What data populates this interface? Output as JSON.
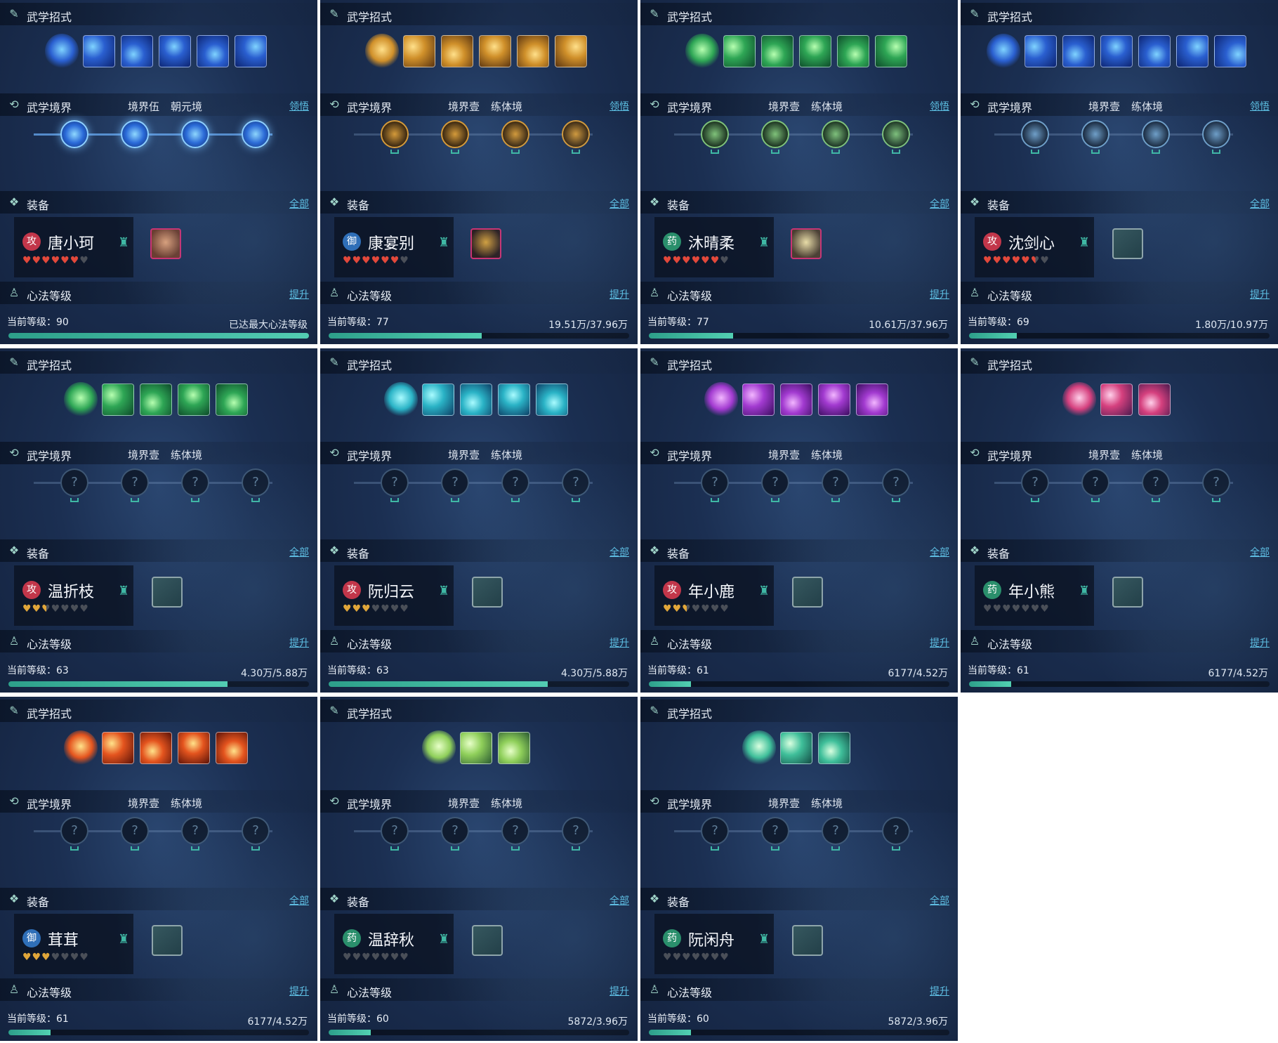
{
  "labels": {
    "skills": "武学招式",
    "realm": "武学境界",
    "equip": "装备",
    "heart": "心法等级",
    "realm_link": "领悟",
    "equip_link": "全部",
    "heart_link": "提升",
    "current_level_prefix": "当前等级："
  },
  "colors": {
    "accent": "#5ec3e6",
    "progress": "#3fb8a4",
    "heart_red": "#e2483b",
    "heart_gold": "#e0a63a",
    "heart_empty": "#4a4f58"
  },
  "panels": [
    {
      "name": "唐小珂",
      "role": "攻",
      "role_color": "#c2364a",
      "realm_level": "境界伍",
      "realm_name": "朝元境",
      "realm_active": true,
      "skill_theme": "blue",
      "skill_count": 5,
      "equip": "armor",
      "hearts": [
        "r",
        "r",
        "r",
        "r",
        "r",
        "r",
        "e"
      ],
      "level": "当前等级：90",
      "exp": "已达最大心法等级",
      "progress": 1.0
    },
    {
      "name": "康宴别",
      "role": "御",
      "role_color": "#2f6fb8",
      "realm_level": "境界壹",
      "realm_name": "练体境",
      "realm_active": false,
      "realm_theme": "gold",
      "skill_theme": "gold",
      "skill_count": 5,
      "equip": "armor2",
      "hearts": [
        "r",
        "r",
        "r",
        "r",
        "r",
        "r",
        "e"
      ],
      "level": "当前等级：77",
      "exp": "19.51万/37.96万",
      "progress": 0.51
    },
    {
      "name": "沐晴柔",
      "role": "药",
      "role_color": "#2a8f6c",
      "realm_level": "境界壹",
      "realm_name": "练体境",
      "realm_active": false,
      "realm_theme": "green",
      "skill_theme": "green",
      "skill_count": 5,
      "equip": "armor3",
      "hearts": [
        "r",
        "r",
        "r",
        "r",
        "r",
        "r",
        "e"
      ],
      "level": "当前等级：77",
      "exp": "10.61万/37.96万",
      "progress": 0.28
    },
    {
      "name": "沈剑心",
      "role": "攻",
      "role_color": "#c2364a",
      "realm_level": "境界壹",
      "realm_name": "练体境",
      "realm_active": false,
      "realm_theme": "blue",
      "skill_theme": "blue",
      "skill_count": 6,
      "equip": "empty",
      "hearts": [
        "r",
        "r",
        "r",
        "r",
        "r",
        "h",
        "e"
      ],
      "level": "当前等级：69",
      "exp": "1.80万/10.97万",
      "progress": 0.16
    },
    {
      "name": "温折枝",
      "role": "攻",
      "role_color": "#c2364a",
      "realm_level": "境界壹",
      "realm_name": "练体境",
      "realm_active": false,
      "skill_theme": "green",
      "skill_count": 4,
      "equip": "empty",
      "hearts": [
        "g",
        "g",
        "hg",
        "e",
        "e",
        "e",
        "e"
      ],
      "level": "当前等级：63",
      "exp": "4.30万/5.88万",
      "progress": 0.73
    },
    {
      "name": "阮归云",
      "role": "攻",
      "role_color": "#c2364a",
      "realm_level": "境界壹",
      "realm_name": "练体境",
      "realm_active": false,
      "skill_theme": "teal",
      "skill_count": 4,
      "equip": "empty",
      "hearts": [
        "g",
        "g",
        "g",
        "e",
        "e",
        "e",
        "e"
      ],
      "level": "当前等级：63",
      "exp": "4.30万/5.88万",
      "progress": 0.73
    },
    {
      "name": "年小鹿",
      "role": "攻",
      "role_color": "#c2364a",
      "realm_level": "境界壹",
      "realm_name": "练体境",
      "realm_active": false,
      "skill_theme": "purple",
      "skill_count": 4,
      "equip": "empty",
      "hearts": [
        "g",
        "g",
        "hg",
        "e",
        "e",
        "e",
        "e"
      ],
      "level": "当前等级：61",
      "exp": "6177/4.52万",
      "progress": 0.14
    },
    {
      "name": "年小熊",
      "role": "药",
      "role_color": "#2a8f6c",
      "realm_level": "境界壹",
      "realm_name": "练体境",
      "realm_active": false,
      "skill_theme": "pink",
      "skill_count": 2,
      "equip": "empty",
      "hearts": [
        "e",
        "e",
        "e",
        "e",
        "e",
        "e",
        "e"
      ],
      "level": "当前等级：61",
      "exp": "6177/4.52万",
      "progress": 0.14
    },
    {
      "name": "茸茸",
      "role": "御",
      "role_color": "#2f6fb8",
      "realm_level": "境界壹",
      "realm_name": "练体境",
      "realm_active": false,
      "skill_theme": "fire",
      "skill_count": 4,
      "equip": "empty",
      "hearts": [
        "g",
        "g",
        "g",
        "e",
        "e",
        "e",
        "e"
      ],
      "level": "当前等级：61",
      "exp": "6177/4.52万",
      "progress": 0.14
    },
    {
      "name": "温辞秋",
      "role": "药",
      "role_color": "#2a8f6c",
      "realm_level": "境界壹",
      "realm_name": "练体境",
      "realm_active": false,
      "skill_theme": "spring",
      "skill_count": 2,
      "equip": "empty",
      "hearts": [
        "e",
        "e",
        "e",
        "e",
        "e",
        "e",
        "e"
      ],
      "level": "当前等级：60",
      "exp": "5872/3.96万",
      "progress": 0.14
    },
    {
      "name": "阮闲舟",
      "role": "药",
      "role_color": "#2a8f6c",
      "realm_level": "境界壹",
      "realm_name": "练体境",
      "realm_active": false,
      "skill_theme": "leaf",
      "skill_count": 2,
      "equip": "empty",
      "hearts": [
        "e",
        "e",
        "e",
        "e",
        "e",
        "e",
        "e"
      ],
      "level": "当前等级：60",
      "exp": "5872/3.96万",
      "progress": 0.14
    }
  ]
}
